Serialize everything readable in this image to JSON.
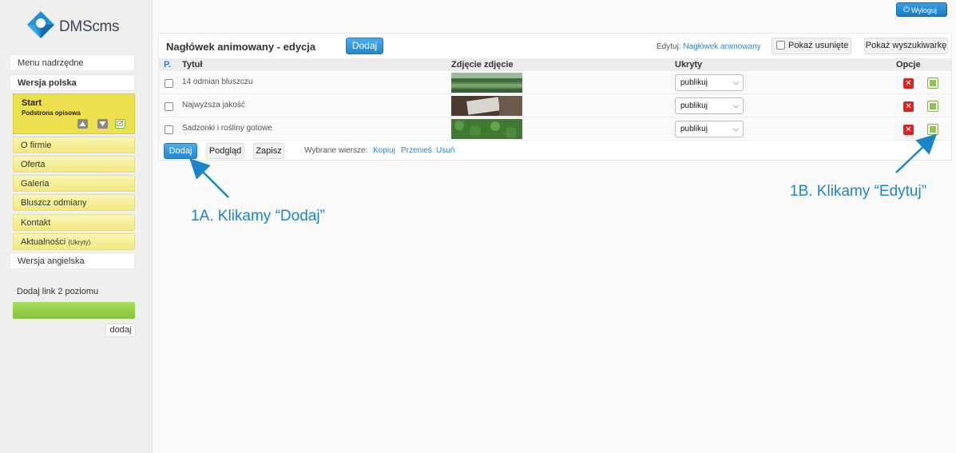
{
  "brand": {
    "name": "DMScms"
  },
  "header": {
    "logout_label": "Wyloguj"
  },
  "sidebar": {
    "menu_parent": "Menu nadrzędne",
    "lang_pl": "Wersja polska",
    "start": {
      "title": "Start",
      "subtitle": "Podstrona opisowa"
    },
    "items": [
      "O firmie",
      "Oferta",
      "Galeria",
      "Bluszcz odmiany",
      "Kontakt"
    ],
    "news": {
      "label": "Aktualności",
      "hidden_note": "(Ukryty)"
    },
    "lang_en": "Wersja angielska",
    "add_link_label": "Dodaj link 2 poziomu",
    "add_button": "dodaj"
  },
  "panel": {
    "title": "Nagłówek animowany - edycja",
    "add_button": "Dodaj",
    "edit_label": "Edytuj:",
    "edit_link": "Nagłówek animowany",
    "show_deleted": "Pokaż usunięte",
    "show_search": "Pokaż wyszukiwarkę"
  },
  "table": {
    "headers": {
      "p": "P.",
      "title": "Tytuł",
      "image": "Zdjęcie zdjęcie",
      "hidden": "Ukryty",
      "options": "Opcje"
    },
    "rows": [
      {
        "title": "14 odmian bluszczu",
        "status": "publikuj"
      },
      {
        "title": "Najwyższa jakość",
        "status": "publikuj"
      },
      {
        "title": "Sadzonki i rośliny gotowe",
        "status": "publikuj"
      }
    ]
  },
  "footer": {
    "add": "Dodaj",
    "preview": "Podgląd",
    "save": "Zapisz",
    "selected_rows": "Wybrane wiersze:",
    "copy": "Kopiuj",
    "move": "Przenieś",
    "delete": "Usuń"
  },
  "annotations": {
    "a": "1A. Klikamy “Dodaj”",
    "b": "1B. Klikamy “Edytuj”"
  },
  "colors": {
    "accent": "#2387d3",
    "annotation": "#1a86c9",
    "start_bg": "#ede04f",
    "green": "#86c23b",
    "delete": "#d9241f"
  }
}
